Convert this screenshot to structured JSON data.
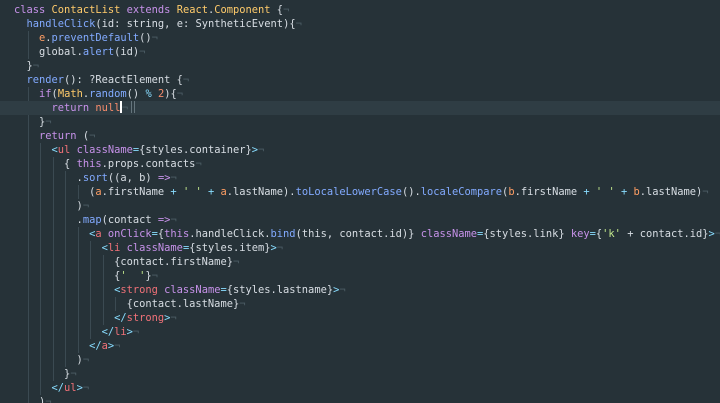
{
  "colors": {
    "background": "#263238",
    "current_line": "#2f3d44",
    "text": "#d8dee4",
    "keyword": "#c792ea",
    "class_name": "#ffcb6b",
    "function": "#82aaff",
    "tag": "#f07178",
    "attribute": "#c792ea",
    "string": "#c3e88d",
    "number": "#f78c6c",
    "punctuation": "#89ddff",
    "invisible": "#4d5e66",
    "variable": "#ff9e64"
  },
  "lines": [
    [
      [
        "class ",
        "keyword"
      ],
      [
        "ContactList",
        "class_name"
      ],
      [
        " extends ",
        "keyword"
      ],
      [
        "React",
        "class_name"
      ],
      [
        ".",
        "text"
      ],
      [
        "Component",
        "class_name"
      ],
      [
        " {",
        "text"
      ]
    ],
    [
      [
        "  handleClick",
        "function"
      ],
      [
        "(",
        "text"
      ],
      [
        "id",
        "text"
      ],
      [
        ": ",
        "text"
      ],
      [
        "string",
        "text"
      ],
      [
        ", ",
        "text"
      ],
      [
        "e",
        "text"
      ],
      [
        ": ",
        "text"
      ],
      [
        "SyntheticEvent",
        "text"
      ],
      [
        "){",
        "text"
      ]
    ],
    [
      [
        "    e",
        "variable"
      ],
      [
        ".",
        "text"
      ],
      [
        "preventDefault",
        "function"
      ],
      [
        "()",
        "text"
      ]
    ],
    [
      [
        "    global",
        "text"
      ],
      [
        ".",
        "text"
      ],
      [
        "alert",
        "function"
      ],
      [
        "(",
        "text"
      ],
      [
        "id",
        "text"
      ],
      [
        ")",
        "text"
      ]
    ],
    [
      [
        "  }",
        "text"
      ]
    ],
    [
      [
        "  render",
        "function"
      ],
      [
        "(): ",
        "text"
      ],
      [
        "?ReactElement",
        "text"
      ],
      [
        " {",
        "text"
      ]
    ],
    [
      [
        "    if",
        "keyword"
      ],
      [
        "(",
        "text"
      ],
      [
        "Math",
        "class_name"
      ],
      [
        ".",
        "text"
      ],
      [
        "random",
        "function"
      ],
      [
        "() ",
        "text"
      ],
      [
        "%",
        "punctuation"
      ],
      [
        " 2",
        "number"
      ],
      [
        "){",
        "text"
      ]
    ],
    [
      [
        "      return ",
        "keyword"
      ],
      [
        "null",
        "number"
      ]
    ],
    [
      [
        "    }",
        "text"
      ]
    ],
    [
      [
        "    return ",
        "keyword"
      ],
      [
        "(",
        "text"
      ]
    ],
    [
      [
        "      <",
        "punctuation"
      ],
      [
        "ul ",
        "tag"
      ],
      [
        "className",
        "attribute"
      ],
      [
        "=",
        "punctuation"
      ],
      [
        "{styles.container}",
        "text"
      ],
      [
        ">",
        "punctuation"
      ]
    ],
    [
      [
        "        { ",
        "text"
      ],
      [
        "this",
        "keyword"
      ],
      [
        ".props.contacts",
        "text"
      ]
    ],
    [
      [
        "          .",
        "text"
      ],
      [
        "sort",
        "function"
      ],
      [
        "((",
        "text"
      ],
      [
        "a",
        "text"
      ],
      [
        ", ",
        "text"
      ],
      [
        "b",
        "text"
      ],
      [
        ") ",
        "text"
      ],
      [
        "=>",
        "keyword"
      ]
    ],
    [
      [
        "            (",
        "text"
      ],
      [
        "a",
        "variable"
      ],
      [
        ".firstName ",
        "text"
      ],
      [
        "+",
        "punctuation"
      ],
      [
        " ' ' ",
        "string"
      ],
      [
        "+",
        "punctuation"
      ],
      [
        " a",
        "variable"
      ],
      [
        ".lastName).",
        "text"
      ],
      [
        "toLocaleLowerCase",
        "function"
      ],
      [
        "().",
        "text"
      ],
      [
        "localeCompare",
        "function"
      ],
      [
        "(",
        "text"
      ],
      [
        "b",
        "variable"
      ],
      [
        ".firstName ",
        "text"
      ],
      [
        "+",
        "punctuation"
      ],
      [
        " ' ' ",
        "string"
      ],
      [
        "+",
        "punctuation"
      ],
      [
        " b",
        "variable"
      ],
      [
        ".lastName)",
        "text"
      ]
    ],
    [
      [
        "          )",
        "text"
      ]
    ],
    [
      [
        "          .",
        "text"
      ],
      [
        "map",
        "function"
      ],
      [
        "(",
        "text"
      ],
      [
        "contact",
        "text"
      ],
      [
        " =>",
        "keyword"
      ]
    ],
    [
      [
        "            <",
        "punctuation"
      ],
      [
        "a ",
        "tag"
      ],
      [
        "onClick",
        "attribute"
      ],
      [
        "=",
        "punctuation"
      ],
      [
        "{",
        "text"
      ],
      [
        "this",
        "keyword"
      ],
      [
        ".handleClick.",
        "text"
      ],
      [
        "bind",
        "function"
      ],
      [
        "(this, contact.id)} ",
        "text"
      ],
      [
        "className",
        "attribute"
      ],
      [
        "=",
        "punctuation"
      ],
      [
        "{styles.link} ",
        "text"
      ],
      [
        "key",
        "attribute"
      ],
      [
        "=",
        "punctuation"
      ],
      [
        "{",
        "text"
      ],
      [
        "'k'",
        "string"
      ],
      [
        " + contact.id}",
        "text"
      ],
      [
        ">",
        "punctuation"
      ]
    ],
    [
      [
        "              <",
        "punctuation"
      ],
      [
        "li ",
        "tag"
      ],
      [
        "className",
        "attribute"
      ],
      [
        "=",
        "punctuation"
      ],
      [
        "{styles.item}",
        "text"
      ],
      [
        ">",
        "punctuation"
      ]
    ],
    [
      [
        "                {contact.firstName}",
        "text"
      ]
    ],
    [
      [
        "                {",
        "text"
      ],
      [
        "'  '",
        "string"
      ],
      [
        "}",
        "text"
      ]
    ],
    [
      [
        "                <",
        "punctuation"
      ],
      [
        "strong ",
        "tag"
      ],
      [
        "className",
        "attribute"
      ],
      [
        "=",
        "punctuation"
      ],
      [
        "{styles.lastname}",
        "text"
      ],
      [
        ">",
        "punctuation"
      ]
    ],
    [
      [
        "                  {contact.lastName}",
        "text"
      ]
    ],
    [
      [
        "                </",
        "punctuation"
      ],
      [
        "strong",
        "tag"
      ],
      [
        ">",
        "punctuation"
      ]
    ],
    [
      [
        "              </",
        "punctuation"
      ],
      [
        "li",
        "tag"
      ],
      [
        ">",
        "punctuation"
      ]
    ],
    [
      [
        "            </",
        "punctuation"
      ],
      [
        "a",
        "tag"
      ],
      [
        ">",
        "punctuation"
      ]
    ],
    [
      [
        "          )",
        "text"
      ]
    ],
    [
      [
        "        }",
        "text"
      ]
    ],
    [
      [
        "      </",
        "punctuation"
      ],
      [
        "ul",
        "tag"
      ],
      [
        ">",
        "punctuation"
      ]
    ],
    [
      [
        "    )",
        "text"
      ]
    ]
  ],
  "eol_marker": "¬",
  "cursor_line": 7
}
